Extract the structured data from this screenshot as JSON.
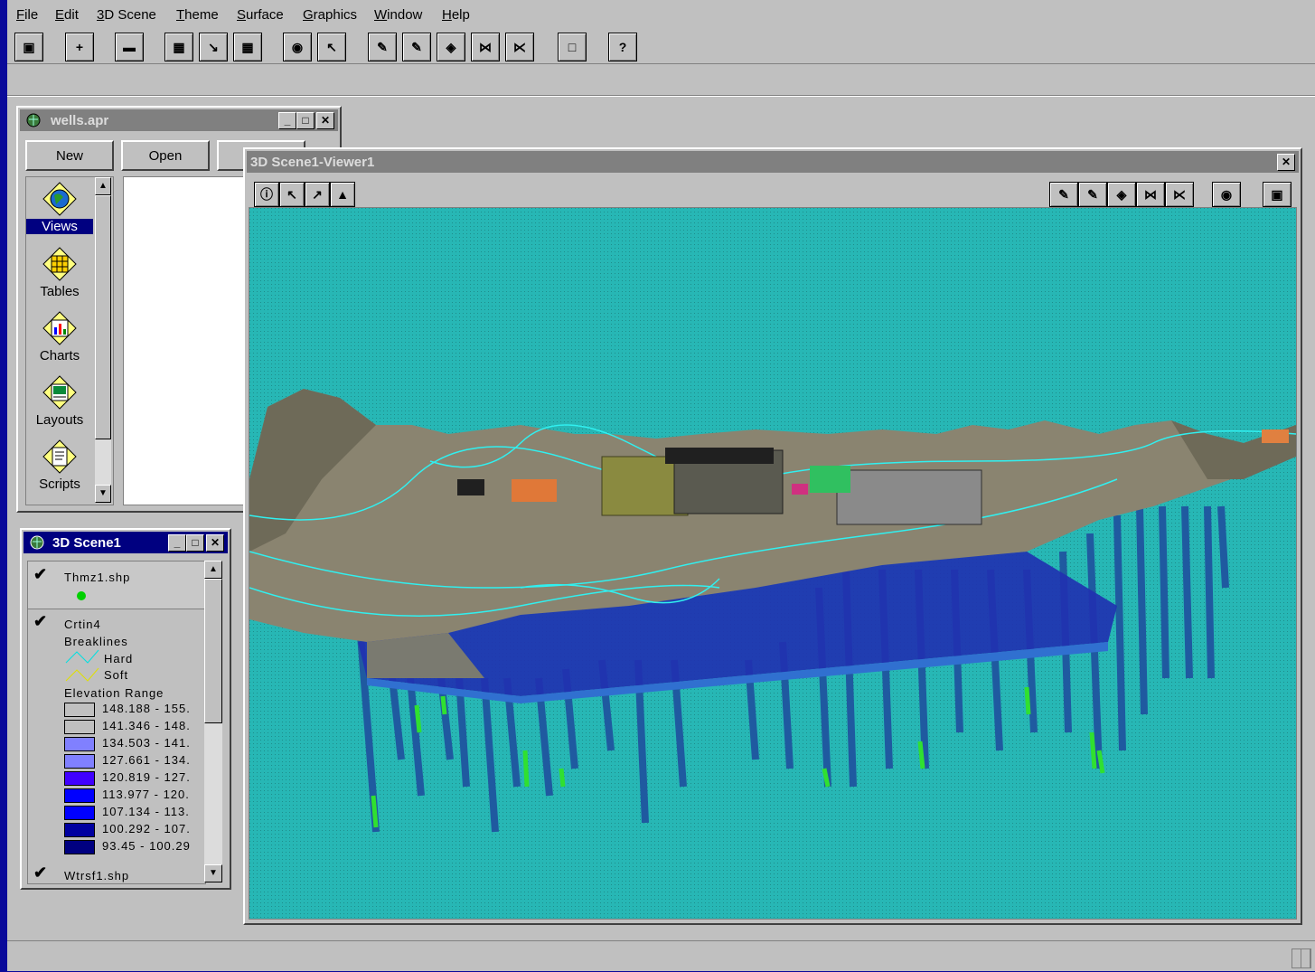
{
  "menubar": {
    "items": [
      {
        "label": "File",
        "accel": "F",
        "rest": "ile"
      },
      {
        "label": "Edit",
        "accel": "E",
        "rest": "dit"
      },
      {
        "label": "3D Scene",
        "accel": "3",
        "rest": "D Scene"
      },
      {
        "label": "Theme",
        "accel": "T",
        "rest": "heme"
      },
      {
        "label": "Surface",
        "accel": "S",
        "rest": "urface"
      },
      {
        "label": "Graphics",
        "accel": "G",
        "rest": "raphics"
      },
      {
        "label": "Window",
        "accel": "W",
        "rest": "indow"
      },
      {
        "label": "Help",
        "accel": "H",
        "rest": "elp"
      }
    ]
  },
  "toolbar": {
    "buttons": [
      "save-icon",
      "add-theme-icon",
      "window-icon",
      "properties-icon",
      "edit-legend-icon",
      "table-icon",
      "find-icon",
      "query-icon",
      "nav-icon-1",
      "nav-icon-2",
      "nav-icon-3",
      "zoom-in-icon",
      "zoom-out-icon",
      "blank-icon",
      "help-icon"
    ]
  },
  "project": {
    "title": "wells.apr",
    "new_label": "New",
    "open_label": "Open",
    "items": [
      {
        "label": "Views",
        "icon": "views-globe-icon"
      },
      {
        "label": "Tables",
        "icon": "tables-grid-icon"
      },
      {
        "label": "Charts",
        "icon": "charts-bar-icon"
      },
      {
        "label": "Layouts",
        "icon": "layouts-icon"
      },
      {
        "label": "Scripts",
        "icon": "scripts-icon"
      }
    ]
  },
  "scene": {
    "title": "3D Scene1",
    "themes": [
      {
        "name": "Thmz1.shp",
        "symbol_color": "#00d000"
      },
      {
        "name": "Crtin4",
        "breaklines_label": "Breaklines",
        "hard_label": "Hard",
        "soft_label": "Soft",
        "elev_label": "Elevation Range"
      },
      {
        "name": "Wtrsf1.shp"
      }
    ],
    "ranges": [
      {
        "label": "148.188 - 155.",
        "color": "#c0c0c0"
      },
      {
        "label": "141.346 - 148.",
        "color": "#c0c0c0"
      },
      {
        "label": "134.503 - 141.",
        "color": "#8080ff"
      },
      {
        "label": "127.661 - 134.",
        "color": "#8080ff"
      },
      {
        "label": "120.819 - 127.",
        "color": "#4000ff"
      },
      {
        "label": "113.977 - 120.",
        "color": "#0000ff"
      },
      {
        "label": "107.134 - 113.",
        "color": "#0000ff"
      },
      {
        "label": "100.292 - 107.",
        "color": "#0000a0"
      },
      {
        "label": "93.45 - 100.29",
        "color": "#000080"
      }
    ]
  },
  "viewer": {
    "title": "3D Scene1-Viewer1",
    "tools": [
      "info-icon",
      "select-icon",
      "select-graphics-icon",
      "navigate-icon"
    ],
    "right_tools": [
      "nav-icon-1",
      "nav-icon-2",
      "nav-icon-3",
      "zoom-in-icon",
      "zoom-out-icon",
      "comment-icon",
      "save-icon"
    ],
    "background": "#27b7b5"
  }
}
